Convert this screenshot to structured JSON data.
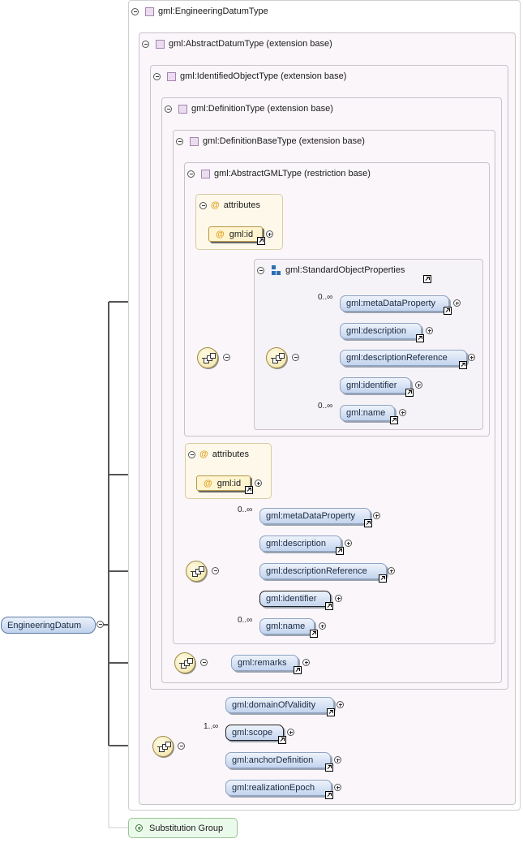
{
  "root_element": {
    "name": "EngineeringDatum"
  },
  "types": {
    "engineering_datum_type": "gml:EngineeringDatumType",
    "abstract_datum_type": "gml:AbstractDatumType (extension base)",
    "identified_object_type": "gml:IdentifiedObjectType (extension base)",
    "definition_type": "gml:DefinitionType (extension base)",
    "definition_base_type": "gml:DefinitionBaseType (extension base)",
    "abstract_gml_type": "gml:AbstractGMLType (restriction base)"
  },
  "attributes_group_1": {
    "title": "attributes",
    "attr": "gml:id",
    "at_symbol": "@"
  },
  "attributes_group_2": {
    "title": "attributes",
    "attr": "gml:id",
    "at_symbol": "@"
  },
  "standard_object_properties": {
    "title": "gml:StandardObjectProperties",
    "elements": [
      {
        "name": "gml:metaDataProperty",
        "cardinality": "0..∞"
      },
      {
        "name": "gml:description",
        "cardinality": ""
      },
      {
        "name": "gml:descriptionReference",
        "cardinality": ""
      },
      {
        "name": "gml:identifier",
        "cardinality": ""
      },
      {
        "name": "gml:name",
        "cardinality": "0..∞"
      }
    ]
  },
  "definition_base_sequence": {
    "elements": [
      {
        "name": "gml:metaDataProperty",
        "cardinality": "0..∞"
      },
      {
        "name": "gml:description",
        "cardinality": ""
      },
      {
        "name": "gml:descriptionReference",
        "cardinality": ""
      },
      {
        "name": "gml:identifier",
        "cardinality": ""
      },
      {
        "name": "gml:name",
        "cardinality": "0..∞"
      }
    ]
  },
  "definition_sequence": {
    "elements": [
      {
        "name": "gml:remarks"
      }
    ]
  },
  "datum_sequence": {
    "elements": [
      {
        "name": "gml:domainOfValidity",
        "cardinality": ""
      },
      {
        "name": "gml:scope",
        "cardinality": "1..∞"
      },
      {
        "name": "gml:anchorDefinition",
        "cardinality": ""
      },
      {
        "name": "gml:realizationEpoch",
        "cardinality": ""
      }
    ]
  },
  "substitution_group": {
    "label": "Substitution Group"
  }
}
